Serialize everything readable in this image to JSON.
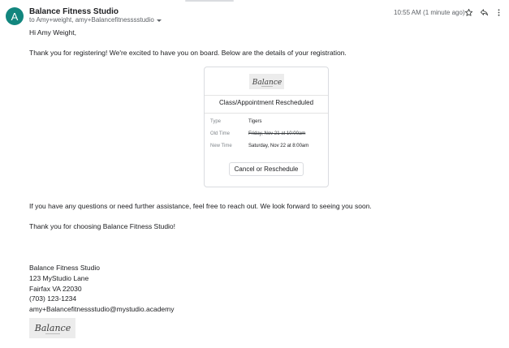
{
  "header": {
    "avatar_letter": "A",
    "sender": "Balance Fitness Studio",
    "recipients": "to Amy+weight, amy+Balancefitnesssstudio",
    "time": "10:55 AM (1 minute ago)"
  },
  "body": {
    "greeting": "Hi Amy Weight,",
    "intro": "Thank you for registering! We're excited to have you on board. Below are the details of your registration.",
    "help": "If you have any questions or need further assistance, feel free to reach out. We look forward to seeing you soon.",
    "thanks": "Thank you for choosing Balance Fitness Studio!"
  },
  "card": {
    "logo_text": "Balance",
    "title": "Class/Appointment Rescheduled",
    "rows": [
      {
        "label": "Type",
        "value": "Tigers"
      },
      {
        "label": "Old Time",
        "value": "Friday, Nov 21 at 10:00am"
      },
      {
        "label": "New Time",
        "value": "Saturday, Nov 22 at 8:00am"
      }
    ],
    "button_label": "Cancel or Reschedule"
  },
  "signature": {
    "name": "Balance Fitness Studio",
    "street": "123 MyStudio Lane",
    "city": "Fairfax VA 22030",
    "phone": "(703) 123-1234",
    "email": "amy+Balancefitnessstudio@mystudio.academy",
    "logo_text": "Balance"
  },
  "colors": {
    "avatar": "#12867e",
    "text": "#202124",
    "muted": "#5f6368"
  },
  "icons": [
    "star-icon",
    "reply-icon",
    "more-vert-icon",
    "chevron-down-icon"
  ]
}
